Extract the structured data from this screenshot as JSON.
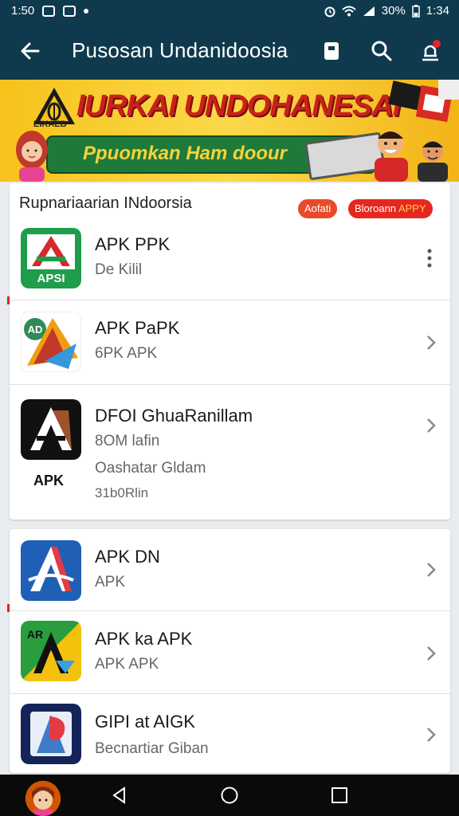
{
  "status_bar": {
    "time": "1:50",
    "battery": "30%",
    "clock_right": "1:34",
    "icons": [
      "gallery-icon",
      "photo-icon",
      "notification-dot",
      "alarm-icon",
      "wifi-icon",
      "signal-icon",
      "battery-icon"
    ]
  },
  "app_bar": {
    "title": "Pusosan Undanidoosia",
    "actions": [
      "bookmark-icon",
      "search-icon",
      "notifications-icon"
    ]
  },
  "banner": {
    "headline": "IURKAI UNDOHANESAI",
    "subtext": "Ppuomkan Ham doour",
    "logo_caption": "EIKAEB"
  },
  "section": {
    "title": "Rupnariaarian INdoorsia",
    "tag1": "Aofati",
    "tag2_main": "Bloroann",
    "tag2_highlight": "APPY"
  },
  "apps_card1": [
    {
      "name": "APK PPK",
      "sub": "De Kilil",
      "icon_label": "APSI",
      "control": "more"
    },
    {
      "name": "APK PaPK",
      "sub": "6PK APK",
      "icon_label": "AD",
      "control": "chevron"
    },
    {
      "name": "DFOI GhuaRanillam",
      "sub": "8OM lafin",
      "sub2": "Oashatar Gldam",
      "sub3": "31b0Rlin",
      "icon_label": "APK",
      "control": "chevron"
    }
  ],
  "apps_card2": [
    {
      "name": "APK DN",
      "sub": "APK",
      "icon_label": "",
      "control": "chevron"
    },
    {
      "name": "APK ka APK",
      "sub": "APK APK",
      "icon_label": "AR",
      "control": "chevron"
    },
    {
      "name": "GIPI at AIGK",
      "sub": "Becnartiar Giban",
      "icon_label": "",
      "control": "chevron"
    }
  ],
  "colors": {
    "app_bar": "#0f3a4d",
    "banner": "#f7c21b",
    "headline": "#c9211b",
    "background": "#e9ecef",
    "nav_bar": "#0a0a0a"
  }
}
